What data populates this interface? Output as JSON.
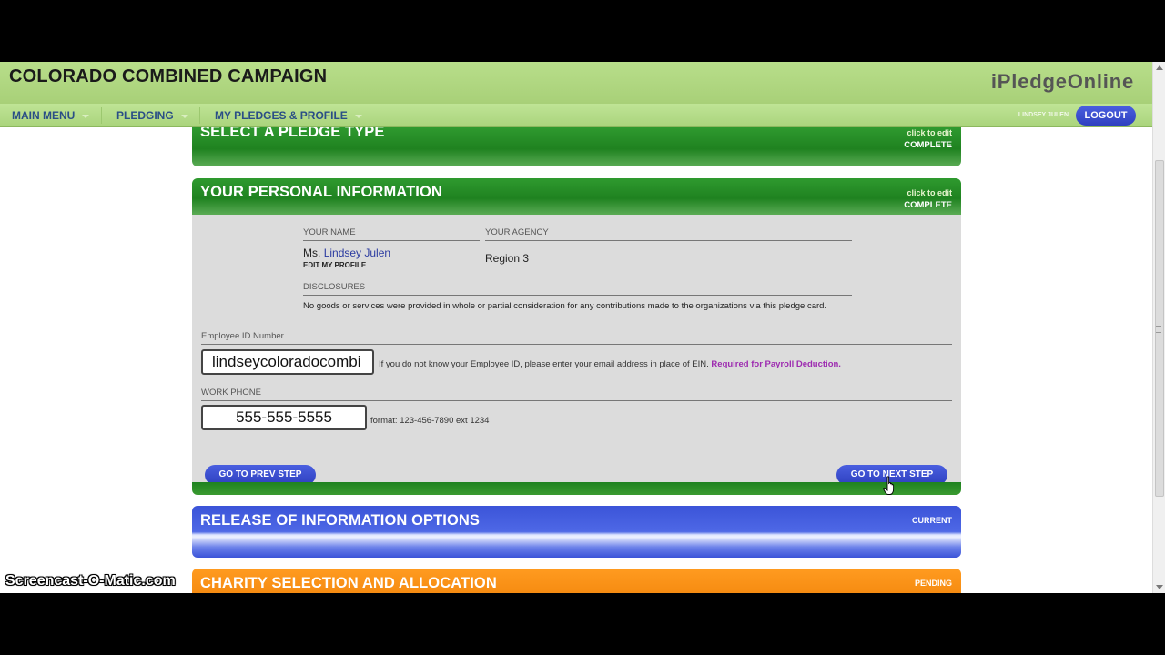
{
  "header": {
    "title": "COLORADO COMBINED CAMPAIGN",
    "brand": "iPledgeOnline"
  },
  "nav": {
    "items": [
      {
        "label": "MAIN MENU"
      },
      {
        "label": "PLEDGING"
      },
      {
        "label": "MY PLEDGES & PROFILE"
      }
    ],
    "user_name": "LINDSEY JULEN",
    "logout_label": "LOGOUT"
  },
  "sections": {
    "select_type": {
      "title": "SELECT A PLEDGE TYPE",
      "edit_label": "click to edit",
      "status": "COMPLETE"
    },
    "personal": {
      "title": "YOUR PERSONAL INFORMATION",
      "edit_label": "click to edit",
      "status": "COMPLETE",
      "your_name_label": "YOUR NAME",
      "name_prefix": "Ms.",
      "name": "Lindsey Julen",
      "edit_profile_label": "EDIT MY PROFILE",
      "agency_label": "YOUR AGENCY",
      "agency_value": "Region 3",
      "disclosures_label": "DISCLOSURES",
      "disclosures_text": "No goods or services were provided in whole or partial consideration for any contributions made to the organizations via this pledge card.",
      "employee_id_label": "Employee ID Number",
      "employee_id_value": "lindseycoloradocombi",
      "employee_id_help": "If you do not know your Employee ID, please enter your email address in place of EIN.",
      "employee_id_required": "Required for Payroll Deduction.",
      "work_phone_label": "WORK PHONE",
      "work_phone_value": "555-555-5555",
      "work_phone_help": "format: 123-456-7890 ext 1234",
      "prev_label": "GO TO PREV STEP",
      "next_label": "GO TO NEXT STEP"
    },
    "release": {
      "title": "RELEASE OF INFORMATION OPTIONS",
      "status": "CURRENT"
    },
    "charity": {
      "title": "CHARITY SELECTION AND ALLOCATION",
      "status": "PENDING"
    }
  },
  "overlay": {
    "watermark": "Screencast-O-Matic.com"
  }
}
